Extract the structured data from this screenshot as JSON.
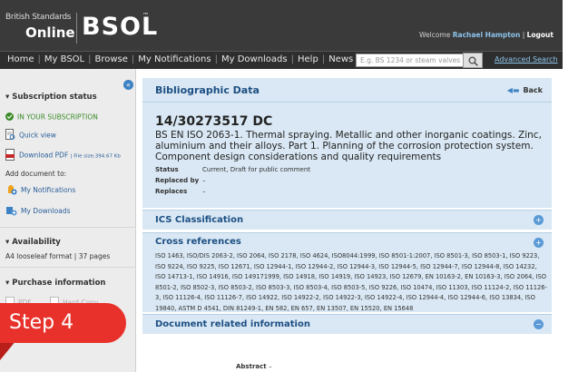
{
  "header": {
    "brand_small": "British Standards",
    "brand_online": "Online",
    "brand_main": "BSOL",
    "brand_tm": "™",
    "welcome_prefix": "Welcome",
    "user_name": "Rachael Hampton",
    "divider": "|",
    "logout_label": "Logout"
  },
  "nav": {
    "items": [
      "Home",
      "My BSOL",
      "Browse",
      "My Notifications",
      "My Downloads",
      "Help",
      "News"
    ],
    "search_placeholder": "E.g. BS 1234 or steam valves",
    "advanced_search_label": "Advanced Search"
  },
  "sidebar": {
    "subscription_heading": "Subscription status",
    "subscription_state": "IN YOUR SUBSCRIPTION",
    "quick_view_label": "Quick view",
    "download_pdf_label": "Download PDF",
    "file_size": "File size:394.67 Kb",
    "add_document_label": "Add document to:",
    "my_notifications_label": "My Notifications",
    "my_downloads_label": "My Downloads",
    "availability_heading": "Availability",
    "availability_text": "A4 looseleaf format | 37 pages",
    "purchase_heading": "Purchase information",
    "purchase_pdf": "PDF",
    "purchase_hardcopy": "Hard Copy"
  },
  "overlay": {
    "step_label": "Step 4"
  },
  "main": {
    "panel_title": "Bibliographic Data",
    "back_label": "Back",
    "doc_id": "14/30273517 DC",
    "doc_title": "BS EN ISO 2063-1. Thermal spraying. Metallic and other inorganic coatings. Zinc, aluminium and their alloys. Part 1. Planning of the corrosion protection system. Component design considerations and quality requirements",
    "status_label": "Status",
    "status_value": "Current, Draft for public comment",
    "replaced_by_label": "Replaced by",
    "replaced_by_value": "–",
    "replaces_label": "Replaces",
    "replaces_value": "–",
    "ics_heading": "ICS Classification",
    "xref_heading": "Cross references",
    "xref_text": "ISO 1463, ISO/DIS 2063-2, ISO 2064, ISO 2178, ISO 4624, ISO8044:1999, ISO 8501-1:2007, ISO 8501-3, ISO 8503-1, ISO 9223, ISO 9224, ISO 9225, ISO 12671, ISO 12944-1, ISO 12944-2, ISO 12944-3, ISO 12944-5, ISO 12944-7, ISO 12944-8, ISO 14232, ISO 14713-1, ISO 14916, ISO 149171999, ISO 14918, ISO 14919, ISO 14923, ISO 12679, EN 10163-2, EN 10163-3, ISO 2064, ISO 8501-2, ISO 8502-3, ISO 8503-2, ISO 8503-3, ISO 8503-4, ISO 8503-5, ISO 9226, ISO 10474, ISO 11303, ISO 11124-2, ISO 11126-3, ISO 11126-4, ISO 11126-7, ISO 14922, ISO 14922-2, ISO 14922-3, ISO 14922-4, ISO 12944-4, ISO 12944-6, ISO 13834, ISO 19840, ASTM D 4541, DIN 81249-1, EN 582, EN 657, EN 13507, EN 15520, EN 15648",
    "doc_related_heading": "Document related information",
    "abstract_label": "Abstract",
    "abstract_value": "–"
  },
  "colors": {
    "header_bg": "#3a3a3a",
    "panel_bg": "#d9e8f4",
    "accent_blue": "#1d4f83",
    "step_red": "#e8312b"
  }
}
